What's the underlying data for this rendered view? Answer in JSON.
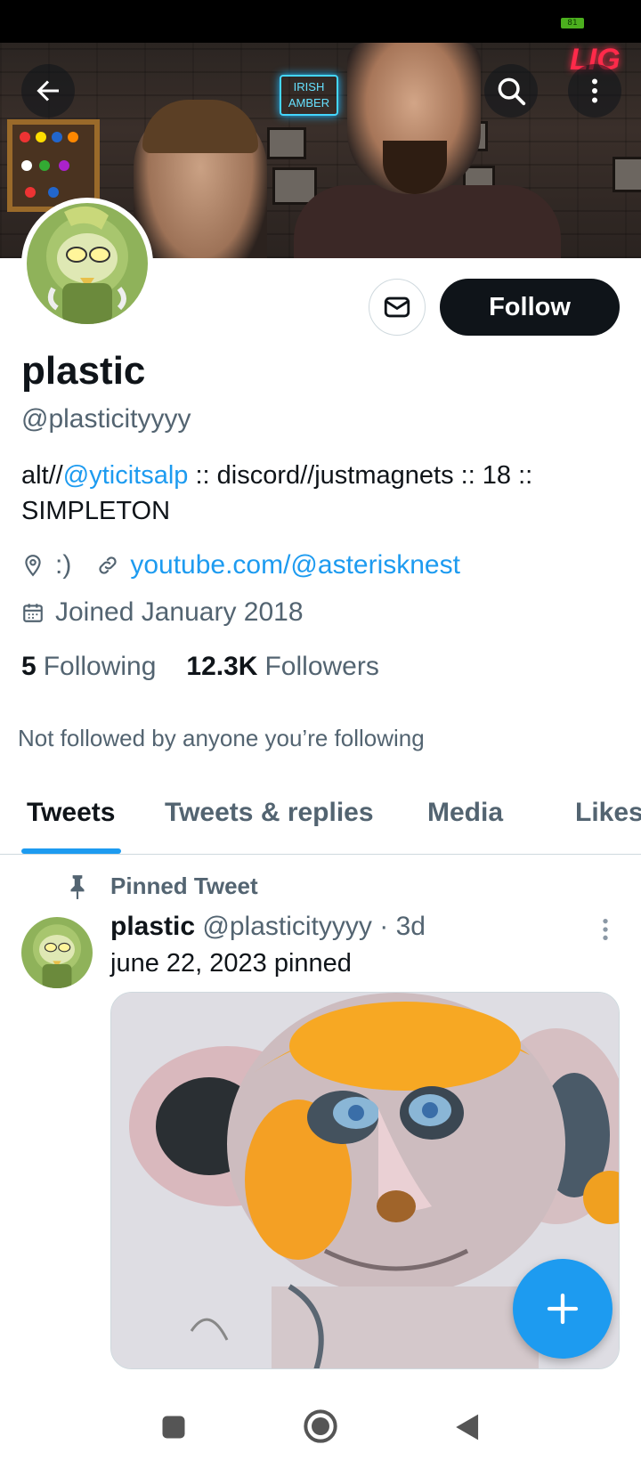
{
  "status_bar": {
    "battery": "81"
  },
  "banner": {
    "sign_text": "IRISH AMBER",
    "neon_text": "LIG"
  },
  "header": {
    "back_icon": "arrow-left-icon",
    "search_icon": "search-icon",
    "more_icon": "more-vertical-icon"
  },
  "profile": {
    "name": "plastic",
    "handle": "@plasticityyyy",
    "bio_prefix": "alt//",
    "bio_mention": "@yticitsalp",
    "bio_suffix": " :: discord//justmagnets :: 18 :: SIMPLETON",
    "location": ":)",
    "website": "youtube.com/@asterisknest",
    "joined": "Joined January 2018",
    "following_count": "5",
    "following_label": "Following",
    "followers_count": "12.3K",
    "followers_label": "Followers",
    "not_followed": "Not followed by anyone you’re following"
  },
  "actions": {
    "follow_label": "Follow",
    "message_icon": "envelope-icon"
  },
  "tabs": [
    {
      "label": "Tweets",
      "active": true
    },
    {
      "label": "Tweets & replies",
      "active": false
    },
    {
      "label": "Media",
      "active": false
    },
    {
      "label": "Likes",
      "active": false
    }
  ],
  "pinned_tweet": {
    "pinned_label": "Pinned Tweet",
    "author_name": "plastic",
    "author_handle": "@plasticityyyy",
    "separator": "·",
    "time": "3d",
    "text": "june 22, 2023 pinned"
  },
  "fab": {
    "icon": "plus-icon"
  },
  "nav_bar": {
    "icons": [
      "recents-icon",
      "home-icon",
      "back-triangle-icon"
    ]
  },
  "colors": {
    "accent": "#1d9bf0",
    "text": "#0f1419",
    "secondary": "#536471",
    "border": "#cfd9de"
  }
}
